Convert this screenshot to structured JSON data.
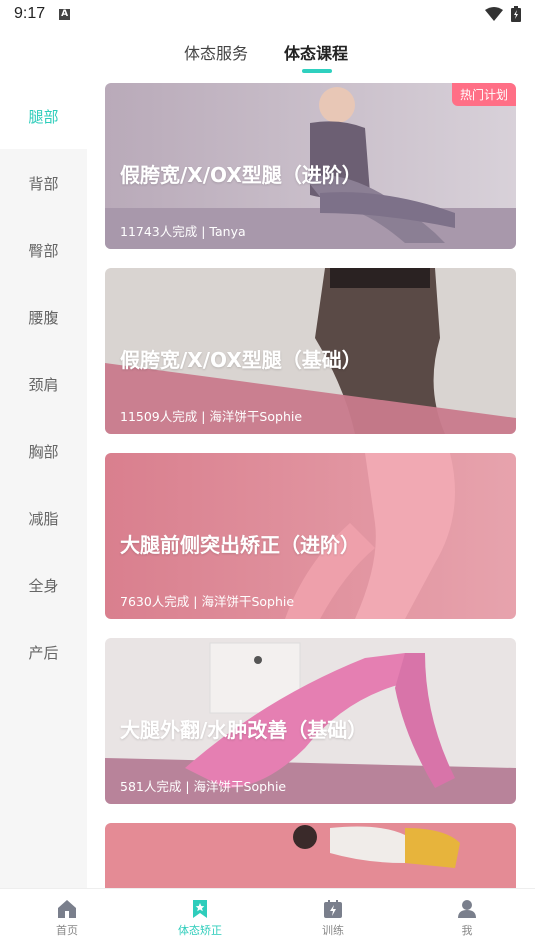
{
  "status_bar": {
    "time": "9:17",
    "notification_letter": "A"
  },
  "top_tabs": [
    {
      "label": "体态服务"
    },
    {
      "label": "体态课程"
    }
  ],
  "sidebar": {
    "items": [
      {
        "label": "腿部"
      },
      {
        "label": "背部"
      },
      {
        "label": "臀部"
      },
      {
        "label": "腰腹"
      },
      {
        "label": "颈肩"
      },
      {
        "label": "胸部"
      },
      {
        "label": "减脂"
      },
      {
        "label": "全身"
      },
      {
        "label": "产后"
      }
    ],
    "active": "腿部"
  },
  "courses": [
    {
      "title": "假胯宽/X/OX型腿（进阶）",
      "meta": "11743人完成 | Tanya",
      "badge": "热门计划"
    },
    {
      "title": "假胯宽/X/OX型腿（基础）",
      "meta": "11509人完成 | 海洋饼干Sophie"
    },
    {
      "title": "大腿前侧突出矫正（进阶）",
      "meta": "7630人完成 | 海洋饼干Sophie"
    },
    {
      "title": "大腿外翻/水肿改善（基础）",
      "meta": "581人完成 | 海洋饼干Sophie"
    },
    {
      "title": "",
      "meta": ""
    }
  ],
  "bottom_nav": [
    {
      "label": "首页",
      "icon": "home-icon"
    },
    {
      "label": "体态矫正",
      "icon": "bookmark-icon"
    },
    {
      "label": "训练",
      "icon": "training-icon"
    },
    {
      "label": "我",
      "icon": "person-icon"
    }
  ],
  "colors": {
    "accent": "#2ecdbb",
    "badge": "#ff6f86",
    "sidebar_bg": "#f6f6f6"
  }
}
